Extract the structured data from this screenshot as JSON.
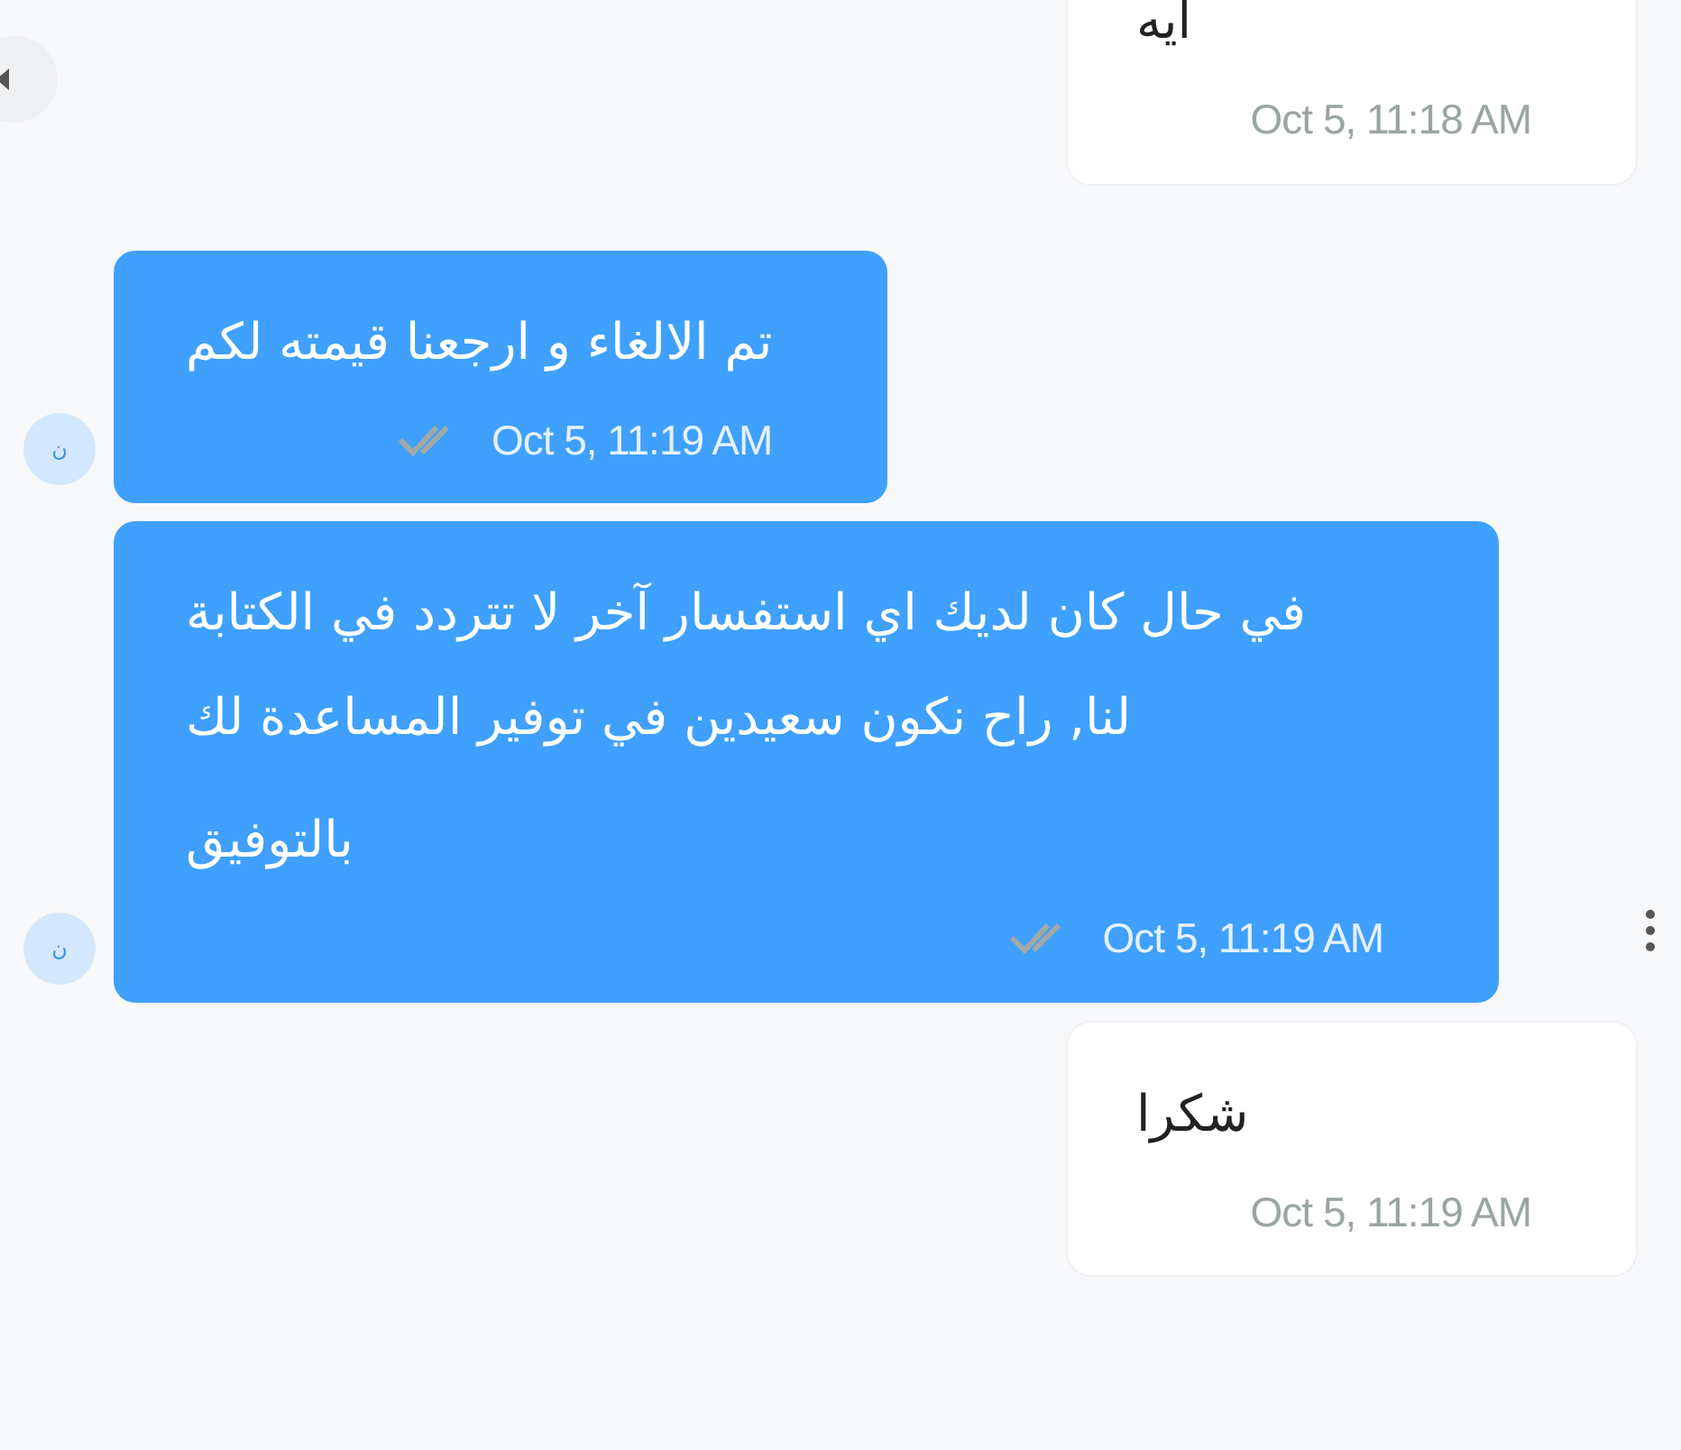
{
  "messages": [
    {
      "kind": "received",
      "paragraphs": [
        "ايه"
      ],
      "time": "Oct 5, 11:18 AM",
      "menu": false
    },
    {
      "kind": "sent",
      "avatar": "ن",
      "paragraphs": [
        "تم الالغاء و ارجعنا قيمته لكم"
      ],
      "time": "Oct 5, 11:19 AM",
      "menu": false
    },
    {
      "kind": "sent",
      "avatar": "ن",
      "paragraphs": [
        "في حال كان لديك اي استفسار آخر لا تتردد في الكتابة لنا, راح نكون سعيدين في توفير المساعدة لك",
        "بالتوفيق"
      ],
      "time": "Oct 5, 11:19 AM",
      "menu": true
    },
    {
      "kind": "received",
      "paragraphs": [
        "شكرا"
      ],
      "time": "Oct 5, 11:19 AM",
      "menu": false
    }
  ]
}
